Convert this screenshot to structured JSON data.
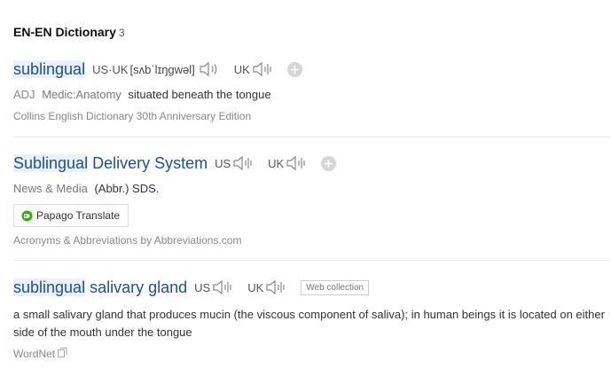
{
  "section": {
    "title": "EN-EN Dictionary",
    "count": "3"
  },
  "entries": [
    {
      "headword_highlight": "sublingual",
      "headword_rest": "",
      "pron_label_1": "US·UK",
      "phonetic": "[sʌbˈlɪŋgwəl]",
      "pron_label_2": "UK",
      "pos": "ADJ",
      "field": "Medic:Anatomy",
      "definition": "situated beneath the tongue",
      "source": "Collins English Dictionary 30th Anniversary Edition"
    },
    {
      "headword_highlight": "Sublingual",
      "headword_rest": " Delivery System",
      "pron_label_1": "US",
      "pron_label_2": "UK",
      "field": "News & Media",
      "definition": "(Abbr.) SDS.",
      "translate_label": "Papago Translate",
      "source": "Acronyms & Abbreviations by Abbreviations.com"
    },
    {
      "headword_highlight": "sublingual",
      "headword_rest": " salivary gland",
      "pron_label_1": "US",
      "pron_label_2": "UK",
      "badge": "Web collection",
      "definition": "a small salivary gland that produces mucin (the viscous component of saliva); in human beings it is located on either side of the mouth under the tongue",
      "source": "WordNet"
    }
  ],
  "icons": {
    "speaker": "speaker-icon",
    "add": "plus-icon",
    "papago": "papago-logo-icon",
    "copy": "copy-icon"
  },
  "colors": {
    "headword": "#1f4e9c",
    "highlight": "#eaf1fb"
  }
}
